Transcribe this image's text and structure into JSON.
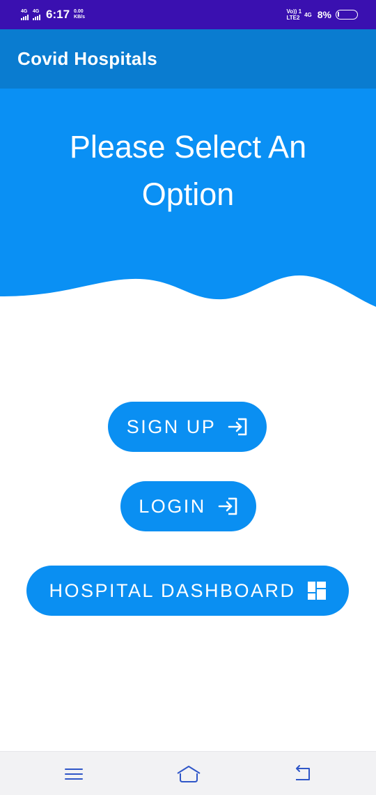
{
  "status_bar": {
    "net1": "4G",
    "net2": "4G",
    "time": "6:17",
    "speed_value": "0.00",
    "speed_unit": "KB/s",
    "volte_top": "Vo)) 1",
    "volte_bottom": "LTE2",
    "net3": "4G",
    "battery_percent": "8%",
    "battery_level": 0.08
  },
  "app_bar": {
    "title": "Covid Hospitals"
  },
  "header": {
    "heading": "Please Select An Option"
  },
  "buttons": {
    "signup": {
      "label": "SIGN UP",
      "icon": "login-arrow-icon"
    },
    "login": {
      "label": "LOGIN",
      "icon": "login-arrow-icon"
    },
    "dashboard": {
      "label": "HOSPITAL DASHBOARD",
      "icon": "dashboard-icon"
    }
  },
  "nav_bar": {
    "items": [
      "menu-icon",
      "home-icon",
      "back-icon"
    ]
  },
  "colors": {
    "status_bar": "#3a10b0",
    "app_bar": "#0a7cd0",
    "header": "#0a90f4",
    "button": "#0a8ff2",
    "nav_icon": "#2f56c8"
  }
}
